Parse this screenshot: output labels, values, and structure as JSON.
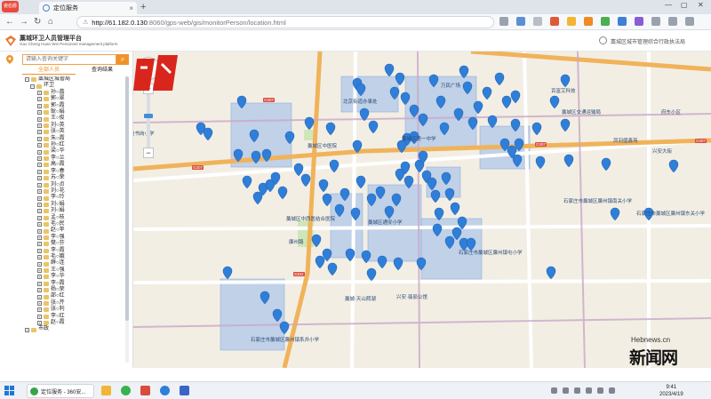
{
  "browser": {
    "badge": "瓷伯爵号",
    "tab_title": "定位服务",
    "url_host": "http://61.182.0.130",
    "url_path": ":8060/gps-web/gis/monitorPerson/location.html"
  },
  "app": {
    "title": "藁城环卫人员管理平台",
    "subtitle": "Gao Cheng Huan Wei Personnel management platform",
    "user": "藁城区城市管理综合行政执法局"
  },
  "panel": {
    "search_placeholder": "请输入查询关键字",
    "tabs": [
      "全部人员",
      "查询结果"
    ],
    "tree_root": "藁城区城管局",
    "tree_group": "环卫",
    "tree_items": [
      "孙○荔",
      "郭○翠",
      "郭○霞",
      "耿○娟",
      "王○俊",
      "刘○英",
      "张○英",
      "朱○霞",
      "孙○红",
      "梁○华",
      "李○兰",
      "高○霞",
      "李○春",
      "苏○荣",
      "刘○贞",
      "刘○花",
      "李○玲",
      "刘○娟",
      "刘○娟",
      "孟○枝",
      "毛○民",
      "赵○苹",
      "李○强",
      "樊○芬",
      "李○霞",
      "毛○娥",
      "薛○连",
      "王○强",
      "李○华",
      "李○霞",
      "杨○荣",
      "邵○红",
      "张○芹",
      "张○利",
      "李○红",
      "赵○霞"
    ],
    "tree_last": "市政"
  },
  "map": {
    "pois": [
      {
        "text": "岗书岗小学"
      },
      {
        "text": "北京街道办事处"
      },
      {
        "text": "百富艾科技"
      },
      {
        "text": "藁城区交通运输局"
      },
      {
        "text": "万民广场"
      },
      {
        "text": "藁城区中医院"
      },
      {
        "text": "藁城区第一中学"
      },
      {
        "text": "藁城区中西医结合医院"
      },
      {
        "text": "藁城区通安小学"
      },
      {
        "text": "石家庄市藁城区廉州镇南关小学"
      },
      {
        "text": "兴安·翡丽公馆"
      },
      {
        "text": "石家庄市藁城区廉州镇东关小学"
      },
      {
        "text": "石家庄市藁城区廉州镇系井小学"
      },
      {
        "text": "藁城·天山熙湖"
      },
      {
        "text": "石家庄市藁城区廉州镇屯小学"
      },
      {
        "text": "凤羽盛鑫苑"
      },
      {
        "text": "廉州路"
      },
      {
        "text": "兴安大街"
      },
      {
        "text": "府东小区"
      }
    ],
    "road_labels": [
      "G307",
      "G307",
      "S302",
      "G307",
      "G307"
    ],
    "pin_color": "#2f7ed8",
    "zone_color": "#a9c4ea",
    "watermark_site": "Hebnews.cn",
    "watermark_text": "新闻网"
  },
  "taskbar": {
    "task_label": "定位服务 - 360安...",
    "time": "9:41",
    "date": "2023/4/19"
  }
}
